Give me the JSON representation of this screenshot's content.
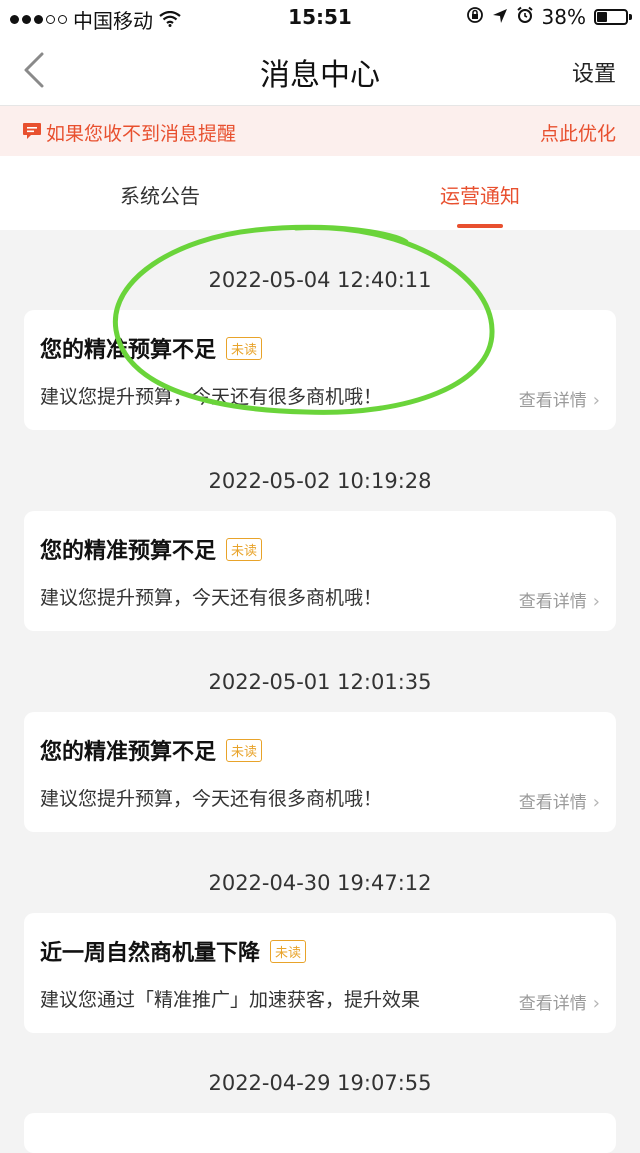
{
  "status_bar": {
    "carrier": "中国移动",
    "time": "15:51",
    "battery_percent": "38%",
    "battery_level": 0.38
  },
  "nav": {
    "title": "消息中心",
    "settings_label": "设置"
  },
  "banner": {
    "text": "如果您收不到消息提醒",
    "action": "点此优化"
  },
  "tabs": [
    {
      "label": "系统公告",
      "active": false
    },
    {
      "label": "运营通知",
      "active": true
    }
  ],
  "messages": [
    {
      "timestamp": "2022-05-04 12:40:11",
      "title": "您的精准预算不足",
      "badge": "未读",
      "body": "建议您提升预算，今天还有很多商机哦！",
      "link": "查看详情"
    },
    {
      "timestamp": "2022-05-02 10:19:28",
      "title": "您的精准预算不足",
      "badge": "未读",
      "body": "建议您提升预算，今天还有很多商机哦！",
      "link": "查看详情"
    },
    {
      "timestamp": "2022-05-01 12:01:35",
      "title": "您的精准预算不足",
      "badge": "未读",
      "body": "建议您提升预算，今天还有很多商机哦！",
      "link": "查看详情"
    },
    {
      "timestamp": "2022-04-30 19:47:12",
      "title": "近一周自然商机量下降",
      "badge": "未读",
      "body": "建议您通过「精准推广」加速获客，提升效果",
      "link": "查看详情"
    }
  ],
  "last_timestamp": "2022-04-29 19:07:55",
  "colors": {
    "accent": "#e8502f",
    "badge": "#e8a32a",
    "highlight_circle": "#6ad43a"
  }
}
